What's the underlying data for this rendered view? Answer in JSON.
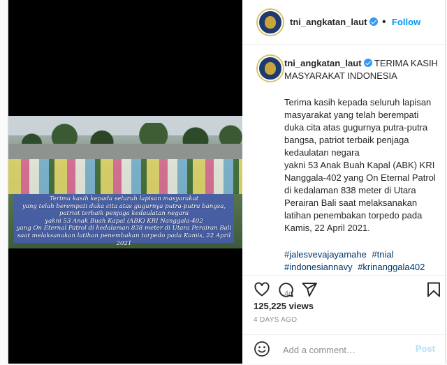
{
  "header": {
    "username": "tni_angkatan_laut",
    "follow_label": "Follow"
  },
  "media": {
    "caption_lines": "Terima kasih kepada seluruh lapisan masyarakat\nyang telah berempati duka cita atas gugurnya putra-putra bangsa,\npatriot terbaik penjaga kedaulatan negara\nyakni 53 Anak Buah Kapal (ABK) KRI Nanggala-402\nyang On Eternal Patrol di kedalaman 838 meter  di Utara Perairan Bali\nsaat melaksanakan latihan penembakan torpedo pada Kamis, 22 April 2021"
  },
  "post": {
    "username": "tni_angkatan_laut",
    "title": "TERIMA KASIH MASYARAKAT INDONESIA",
    "body": "Terima kasih kepada seluruh lapisan masyarakat yang telah berempati duka cita atas gugurnya putra-putra bangsa, patriot terbaik penjaga kedaulatan negara\nyakni 53 Anak Buah Kapal (ABK) KRI Nanggala-402 yang On Eternal Patrol di kedalaman 838 meter di Utara Perairan Bali saat melaksanakan latihan penembakan torpedo pada Kamis, 22 April 2021.",
    "hashtags": [
      "#jalesvevajayamahe",
      "#tnial",
      "#indonesiannavy",
      "#krinanggala402"
    ],
    "relative_time": "4d"
  },
  "actions": {
    "views": "125,225 views",
    "date": "4 DAYS AGO",
    "comment_placeholder": "Add a comment…",
    "post_label": "Post",
    "icons": [
      "heart-icon",
      "comment-icon",
      "share-icon",
      "bookmark-icon",
      "emoji-icon"
    ]
  },
  "colors": {
    "link": "#0095f6",
    "hashtag": "#00376b",
    "muted": "#8e8e8e",
    "caption_box": "#465cbe"
  }
}
